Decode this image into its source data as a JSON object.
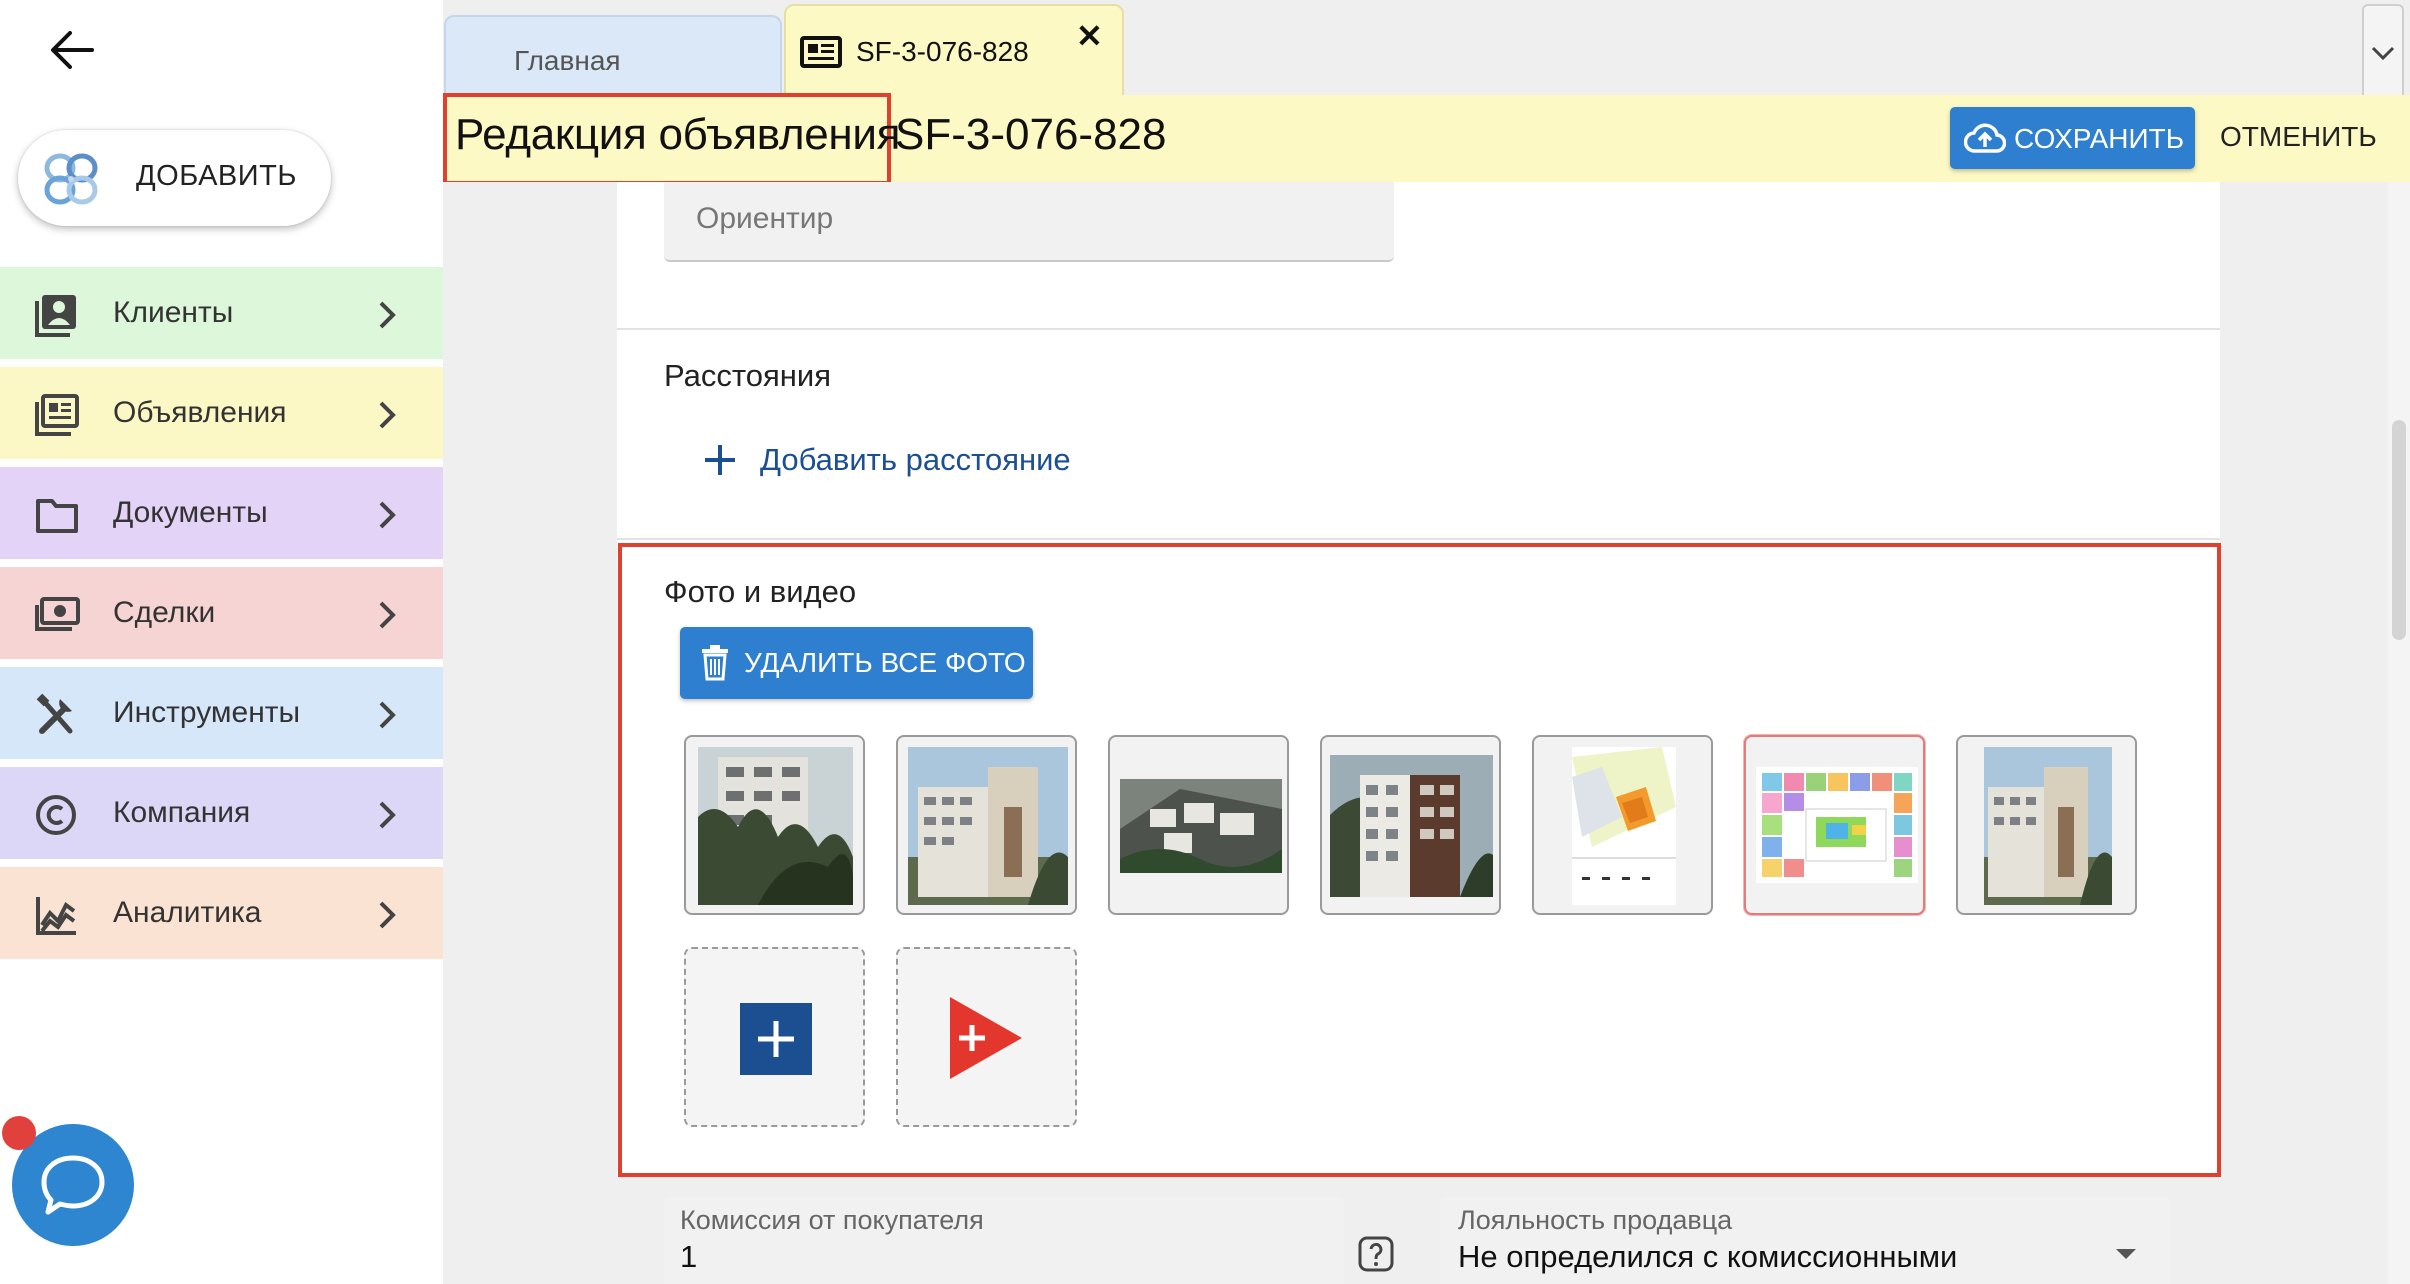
{
  "sidebar": {
    "add_label": "ДОБАВИТЬ",
    "items": [
      {
        "label": "Клиенты",
        "icon": "contacts-icon",
        "color": "#dcf7d9"
      },
      {
        "label": "Объявления",
        "icon": "listings-icon",
        "color": "#fbf8c5"
      },
      {
        "label": "Документы",
        "icon": "folder-icon",
        "color": "#e3d3f7"
      },
      {
        "label": "Сделки",
        "icon": "money-icon",
        "color": "#f7d4d4"
      },
      {
        "label": "Инструменты",
        "icon": "tools-icon",
        "color": "#d6e7fa"
      },
      {
        "label": "Компания",
        "icon": "copyright-icon",
        "color": "#dcd7f7"
      },
      {
        "label": "Аналитика",
        "icon": "analytics-icon",
        "color": "#fae3d2"
      }
    ]
  },
  "tabs": {
    "home_label": "Главная",
    "active_label": "SF-3-076-828",
    "close_glyph": "✕"
  },
  "header": {
    "title": "Редакция объявления",
    "code": "SF-3-076-828",
    "save_label": "СОХРАНИТЬ",
    "cancel_label": "ОТМЕНИТЬ"
  },
  "form": {
    "orient_placeholder": "Ориентир",
    "distances_title": "Расстояния",
    "add_distance_label": "Добавить расстояние",
    "media_title": "Фото и видео",
    "delete_all_label": "УДАЛИТЬ ВСЕ ФОТО",
    "commission_label": "Комиссия от покупателя",
    "commission_value": "1",
    "loyalty_label": "Лояльность продавца",
    "loyalty_value": "Не определился с комиссионными"
  },
  "colors": {
    "accent": "#2e7fcf",
    "highlight_border": "#e0412f",
    "tab_active_bg": "#fcf9c4",
    "tab_home_bg": "#dbe8f8",
    "link": "#1c4f91"
  }
}
